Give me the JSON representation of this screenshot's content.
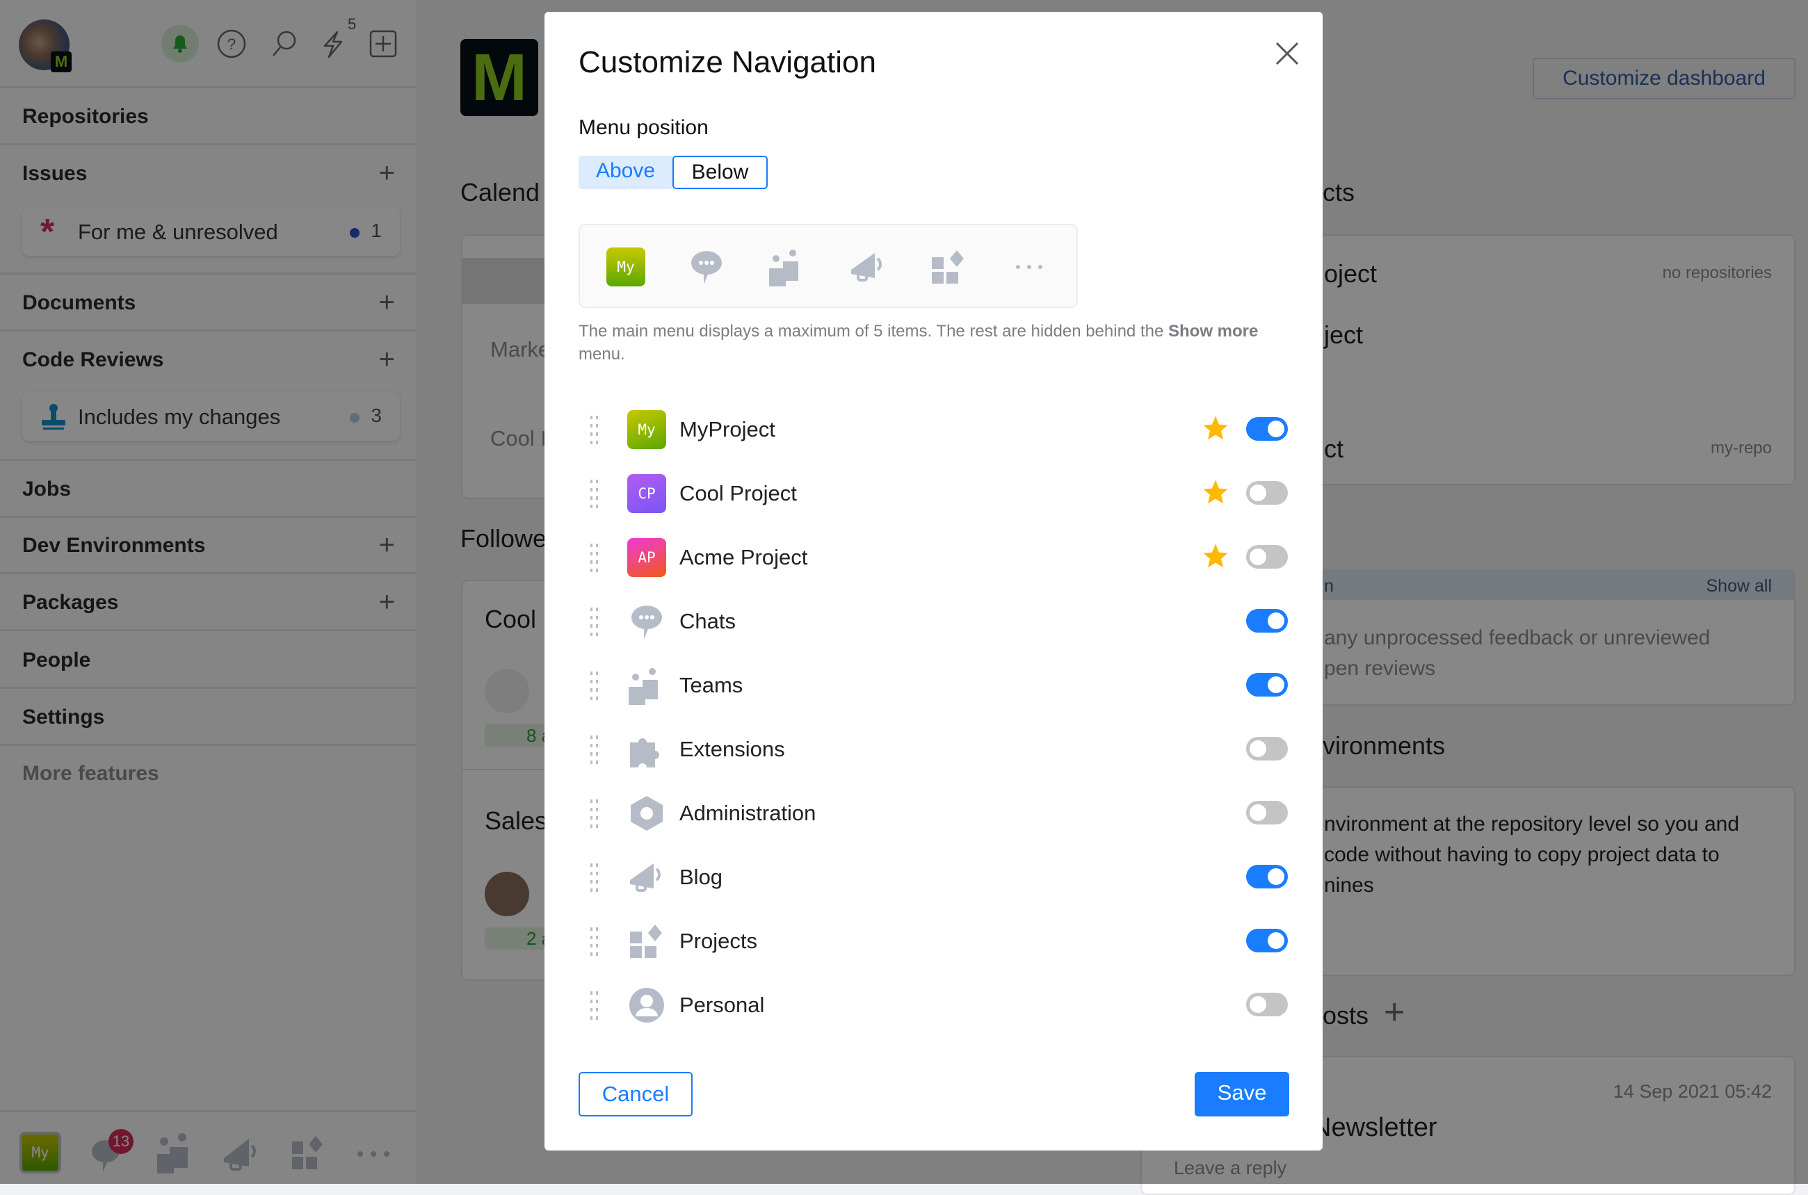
{
  "sidebar": {
    "header": {
      "notification_count": "5"
    },
    "items": [
      {
        "label": "Repositories",
        "plus": false
      },
      {
        "label": "Issues",
        "plus": true
      },
      {
        "label": "Documents",
        "plus": true
      },
      {
        "label": "Code Reviews",
        "plus": true
      },
      {
        "label": "Jobs",
        "plus": false
      },
      {
        "label": "Dev Environments",
        "plus": true
      },
      {
        "label": "Packages",
        "plus": true
      },
      {
        "label": "People",
        "plus": false
      },
      {
        "label": "Settings",
        "plus": false
      }
    ],
    "issues_filter": {
      "label": "For me & unresolved",
      "count": "1"
    },
    "reviews_filter": {
      "label": "Includes my changes",
      "count": "3"
    },
    "more_features": "More features",
    "bottom_bar": {
      "my_label": "My",
      "chats_badge": "13"
    }
  },
  "background": {
    "calendar_title": "Calend",
    "calendar_rows": [
      "Marke",
      "Cool I"
    ],
    "followed_title": "Followe",
    "followed_cards": [
      {
        "title": "Cool",
        "meta": "8 a"
      },
      {
        "title": "Sales",
        "meta": "2 a"
      }
    ],
    "customize_dashboard": "Customize dashboard",
    "projects_title": "cts",
    "projects": [
      {
        "name": "oject",
        "meta": "no repositories"
      },
      {
        "name": "ject",
        "meta": ""
      },
      {
        "name": "ct",
        "meta": "my-repo"
      }
    ],
    "reviews_header": "n",
    "show_all": "Show all",
    "reviews_text": [
      "any unprocessed feedback or unreviewed",
      "pen reviews"
    ],
    "dev_env_title": "vironments",
    "dev_env_text": [
      "nvironment at the repository level so you and",
      "code without having to copy project data to",
      "nines"
    ],
    "posts_title": "osts",
    "post_date": "14 Sep 2021 05:42",
    "post_title": "Newsletter",
    "post_reply": "Leave a reply"
  },
  "dialog": {
    "title": "Customize Navigation",
    "menu_position_label": "Menu position",
    "position_options": [
      "Above",
      "Below"
    ],
    "position_selected": "Above",
    "preview_icons": [
      "my-project-icon",
      "chats-icon",
      "teams-icon",
      "blog-icon",
      "projects-icon",
      "more-icon"
    ],
    "preview_my_label": "My",
    "help_text_1": "The main menu displays a maximum of 5 items. The rest are hidden behind the ",
    "help_bold": "Show more",
    "help_text_2": " menu.",
    "items": [
      {
        "label": "MyProject",
        "icon": "badge",
        "badge": "My",
        "colors": [
          "#c8c800",
          "#5aa800"
        ],
        "starred": true,
        "enabled": true
      },
      {
        "label": "Cool Project",
        "icon": "badge",
        "badge": "CP",
        "colors": [
          "#b35cf0",
          "#7a55f5"
        ],
        "starred": true,
        "enabled": false
      },
      {
        "label": "Acme Project",
        "icon": "badge",
        "badge": "AP",
        "colors": [
          "#ee3ad8",
          "#f05a18"
        ],
        "starred": true,
        "enabled": false
      },
      {
        "label": "Chats",
        "icon": "chats",
        "starred": false,
        "enabled": true
      },
      {
        "label": "Teams",
        "icon": "teams",
        "starred": false,
        "enabled": true
      },
      {
        "label": "Extensions",
        "icon": "puzzle",
        "starred": false,
        "enabled": false
      },
      {
        "label": "Administration",
        "icon": "hexagon",
        "starred": false,
        "enabled": false
      },
      {
        "label": "Blog",
        "icon": "megaphone",
        "starred": false,
        "enabled": true
      },
      {
        "label": "Projects",
        "icon": "projects",
        "starred": false,
        "enabled": true
      },
      {
        "label": "Personal",
        "icon": "person",
        "starred": false,
        "enabled": false
      }
    ],
    "cancel_label": "Cancel",
    "save_label": "Save"
  },
  "colors": {
    "accent": "#1a7cff",
    "star": "#ffba00",
    "toggle_off": "#c4c4c4",
    "icon_gray": "#b5bcc8"
  }
}
